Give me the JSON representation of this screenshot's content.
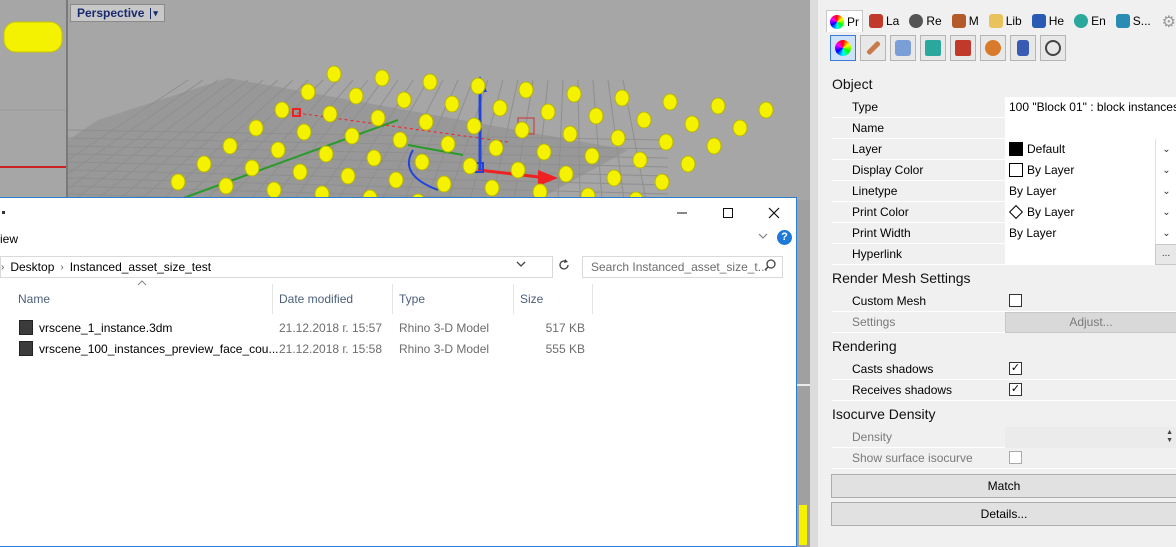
{
  "viewport": {
    "title": "Perspective",
    "caret": "▾"
  },
  "explorer": {
    "ribbon_tab": "iew",
    "help": "?",
    "breadcrumb": [
      "Desktop",
      "Instanced_asset_size_test"
    ],
    "search_placeholder": "Search Instanced_asset_size_t...",
    "columns": [
      "Name",
      "Date modified",
      "Type",
      "Size"
    ],
    "files": [
      {
        "name": "vrscene_1_instance.3dm",
        "date": "21.12.2018 г. 15:57",
        "type": "Rhino 3-D Model",
        "size": "517 KB"
      },
      {
        "name": "vrscene_100_instances_preview_face_cou...",
        "date": "21.12.2018 г. 15:58",
        "type": "Rhino 3-D Model",
        "size": "555 KB"
      }
    ]
  },
  "properties": {
    "tabs": [
      {
        "label": "Pr",
        "icon": "properties-icon",
        "color": "#c23ac9"
      },
      {
        "label": "La",
        "icon": "layers-icon",
        "color": "#c0392b"
      },
      {
        "label": "Re",
        "icon": "render-icon",
        "color": "#444444"
      },
      {
        "label": "M",
        "icon": "materials-icon",
        "color": "#b35b2a"
      },
      {
        "label": "Lib",
        "icon": "libraries-icon",
        "color": "#d4a62a"
      },
      {
        "label": "He",
        "icon": "help-icon",
        "color": "#2a5bb3"
      },
      {
        "label": "En",
        "icon": "environment-icon",
        "color": "#2aa89b"
      },
      {
        "label": "S...",
        "icon": "sun-icon",
        "color": "#2a8bb3"
      }
    ],
    "object_section": "Object",
    "object_rows": [
      {
        "label": "Type",
        "value": "100 \"Block 01\" : block instances"
      },
      {
        "label": "Name",
        "value": ""
      },
      {
        "label": "Layer",
        "value": "Default"
      },
      {
        "label": "Display Color",
        "value": "By Layer"
      },
      {
        "label": "Linetype",
        "value": "By Layer"
      },
      {
        "label": "Print Color",
        "value": "By Layer"
      },
      {
        "label": "Print Width",
        "value": "By Layer"
      },
      {
        "label": "Hyperlink",
        "value": "",
        "button": "..."
      }
    ],
    "render_mesh_section": "Render Mesh Settings",
    "custom_mesh_label": "Custom Mesh",
    "settings_label": "Settings",
    "adjust_label": "Adjust...",
    "rendering_section": "Rendering",
    "casts_shadows_label": "Casts shadows",
    "receives_shadows_label": "Receives shadows",
    "check": "✓",
    "isocurve_section": "Isocurve Density",
    "density_label": "Density",
    "show_isocurve_label": "Show surface isocurve",
    "match_label": "Match",
    "details_label": "Details..."
  }
}
